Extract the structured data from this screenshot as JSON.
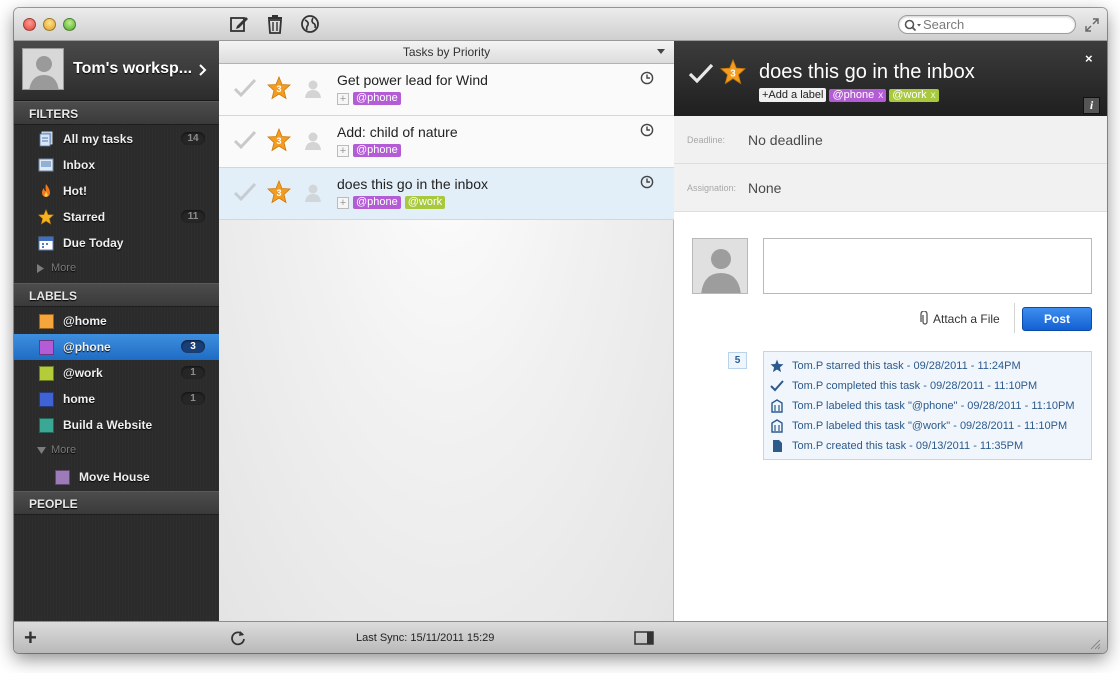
{
  "search": {
    "placeholder": "Search"
  },
  "workspace": {
    "name": "Tom's worksp..."
  },
  "sidebar": {
    "filters_title": "FILTERS",
    "filters": [
      {
        "label": "All my tasks",
        "count": "14",
        "icon": "documents-icon"
      },
      {
        "label": "Inbox",
        "count": "",
        "icon": "inbox-icon"
      },
      {
        "label": "Hot!",
        "count": "",
        "icon": "flame-icon"
      },
      {
        "label": "Starred",
        "count": "11",
        "icon": "star-icon"
      },
      {
        "label": "Due Today",
        "count": "",
        "icon": "calendar-icon"
      }
    ],
    "filters_more": "More",
    "labels_title": "LABELS",
    "labels": [
      {
        "label": "@home",
        "count": "",
        "color": "#f5a53a"
      },
      {
        "label": "@phone",
        "count": "3",
        "color": "#b35cd6"
      },
      {
        "label": "@work",
        "count": "1",
        "color": "#b4cb3a"
      },
      {
        "label": "home",
        "count": "1",
        "color": "#3f62d6"
      },
      {
        "label": "Build a Website",
        "count": "",
        "color": "#3aa894"
      }
    ],
    "labels_more": "More",
    "sublabels": [
      {
        "label": "Move House",
        "color": "#9c7bb8"
      }
    ],
    "people_title": "PEOPLE"
  },
  "tasklist": {
    "header": "Tasks by Priority",
    "tasks": [
      {
        "title": "Get power lead for Wind",
        "priority": "3",
        "labels": [
          "@phone"
        ]
      },
      {
        "title": "Add: child of nature",
        "priority": "3",
        "labels": [
          "@phone"
        ]
      },
      {
        "title": "does this go in the inbox",
        "priority": "3",
        "labels": [
          "@phone",
          "@work"
        ]
      }
    ]
  },
  "detail": {
    "title": "does this go in the inbox",
    "priority": "3",
    "add_label": "+Add a label",
    "labels": [
      {
        "label": "@phone",
        "remove": "x"
      },
      {
        "label": "@work",
        "remove": "x"
      }
    ],
    "close": "×",
    "info": "i",
    "deadline_key": "Deadline:",
    "deadline_value": "No deadline",
    "assignation_key": "Assignation:",
    "assignation_value": "None",
    "attach_label": "Attach a File",
    "post_label": "Post",
    "activity_count": "5",
    "activity": [
      {
        "icon": "star-icon",
        "text": "Tom.P starred this task - 09/28/2011 - 11:24PM"
      },
      {
        "icon": "checkmark-icon",
        "text": "Tom.P completed this task - 09/28/2011 - 11:10PM"
      },
      {
        "icon": "label-icon",
        "text": "Tom.P labeled this task \"@phone\" - 09/28/2011 - 11:10PM"
      },
      {
        "icon": "label-icon",
        "text": "Tom.P labeled this task \"@work\" - 09/28/2011 - 11:10PM"
      },
      {
        "icon": "document-icon",
        "text": "Tom.P created this task - 09/13/2011 - 11:35PM"
      }
    ]
  },
  "bottombar": {
    "add": "+",
    "sync_text": "Last Sync: 15/11/2011 15:29"
  },
  "colors": {
    "accent": "#1f6cc4",
    "phone": "#b35cd6",
    "work": "#a8c83e",
    "star": "#f39c1f"
  }
}
